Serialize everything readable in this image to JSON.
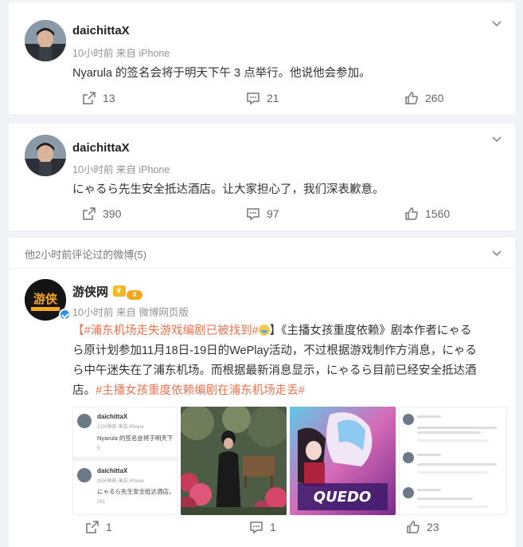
{
  "posts": [
    {
      "user": "daichittaX",
      "meta": "10小时前 来自 iPhone",
      "text": "Nyarula 的签名会将于明天下午 3 点举行。他说他会参加。",
      "reposts": "13",
      "comments": "21",
      "likes": "260"
    },
    {
      "user": "daichittaX",
      "meta": "10小时前 来自 iPhone",
      "text": "にゃるら先生安全抵达酒店。让大家担心了，我们深表歉意。",
      "reposts": "390",
      "comments": "97",
      "likes": "1560"
    }
  ],
  "feed_header": "他2小时前评论过的微博(5)",
  "main_post": {
    "user": "游侠网",
    "level_badge": "II",
    "meta": "10小时前 来自 微博网页版",
    "tag1": "#浦东机场走失游戏编剧已被找到#",
    "line1_a": "】《主播女孩重度依赖》剧本作者にゃる",
    "line2": "ら原计划参加11月18日-19日的WePlay活动，不过根据游戏制作方消息，にゃる",
    "line3": "ら中午迷失在了浦东机场。而根据最新消息显示，にゃるら目前已经安全抵达酒",
    "line4_a": "店。",
    "tag2": "#主播女孩重度依赖编剧在浦东机场走丢#",
    "reposts": "1",
    "comments": "1",
    "likes": "23",
    "thumb1": {
      "user1": "daichittaX",
      "meta1": "21分钟前 来自 iPhone",
      "text1": "Nyarula 的签名会将于明天下",
      "count1": "5",
      "user2": "daichittaX",
      "meta2": "25分钟前 来自 iPhone",
      "text2": "にゃるら先生安全抵达酒店。",
      "count2": "261"
    }
  },
  "colors": {
    "accent": "#eb7350",
    "meta": "#939393",
    "verified": "#2d8ff0"
  }
}
